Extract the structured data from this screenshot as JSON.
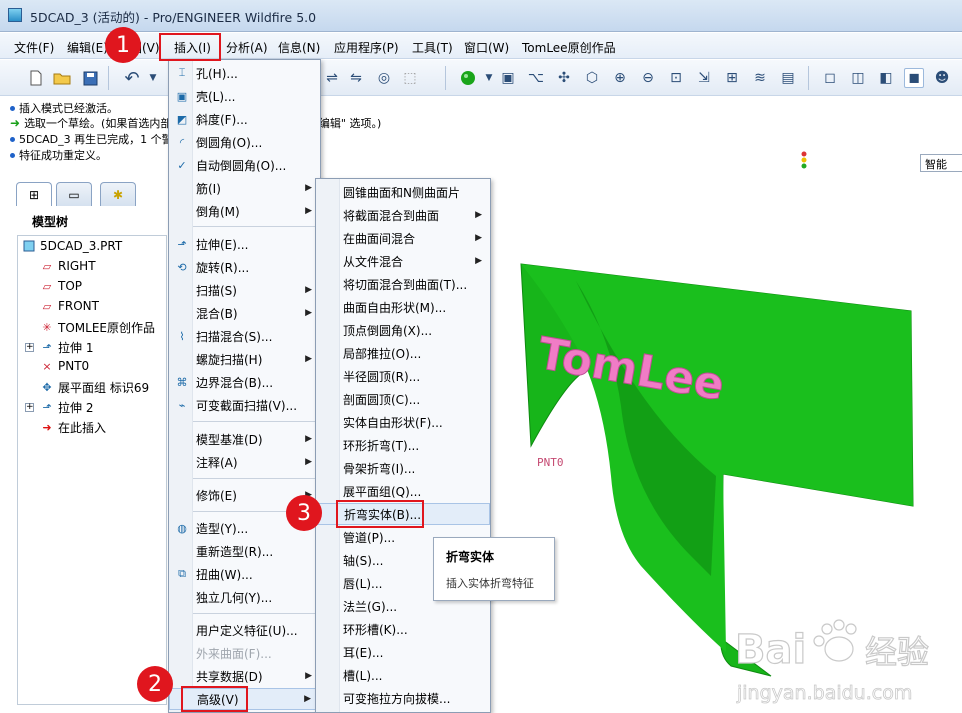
{
  "window": {
    "title": "5DCAD_3 (活动的) - Pro/ENGINEER Wildfire 5.0"
  },
  "menubar": {
    "items": [
      "文件(F)",
      "编辑(E)",
      "视图(V)",
      "插入(I)",
      "分析(A)",
      "信息(N)",
      "应用程序(P)",
      "工具(T)",
      "窗口(W)",
      "TomLee原创作品"
    ]
  },
  "messages": [
    {
      "icon": "info-bullet",
      "text": "插入模式已经激活。"
    },
    {
      "icon": "arrow-prompt",
      "text": "选取一个草绘。(如果首选内部草绘，可在 放置 面板中找到 \"编辑\" 选项。)"
    },
    {
      "icon": "info-bullet",
      "text": "5DCAD_3 再生已完成，1 个警告。"
    },
    {
      "icon": "info-bullet",
      "text": "特征成功重定义。"
    }
  ],
  "filter": {
    "value": "智能"
  },
  "model_tree": {
    "title": "模型树",
    "nodes": [
      {
        "label": "5DCAD_3.PRT",
        "icon": "part-icon"
      },
      {
        "label": "RIGHT",
        "icon": "datum-plane-icon"
      },
      {
        "label": "TOP",
        "icon": "datum-plane-icon"
      },
      {
        "label": "FRONT",
        "icon": "datum-plane-icon"
      },
      {
        "label": "TOMLEE原创作品",
        "icon": "csys-icon"
      },
      {
        "label": "拉伸 1",
        "icon": "extrude-icon"
      },
      {
        "label": "PNT0",
        "icon": "datum-point-icon"
      },
      {
        "label": "展平面组 标识69",
        "icon": "flatten-quilt-icon"
      },
      {
        "label": "拉伸 2",
        "icon": "extrude-icon"
      },
      {
        "label": "在此插入",
        "icon": "insert-here-arrow-icon"
      }
    ]
  },
  "insert_menu": {
    "items": [
      {
        "label": "孔(H)...",
        "icon": "hole-icon"
      },
      {
        "label": "壳(L)...",
        "icon": "shell-icon"
      },
      {
        "label": "斜度(F)...",
        "icon": "draft-icon"
      },
      {
        "label": "倒圆角(O)...",
        "icon": "round-icon"
      },
      {
        "label": "自动倒圆角(O)...",
        "icon": "auto-round-icon"
      },
      {
        "label": "筋(I)",
        "submenu": true
      },
      {
        "label": "倒角(M)",
        "submenu": true
      },
      {
        "label": "拉伸(E)...",
        "icon": "extrude-icon"
      },
      {
        "label": "旋转(R)...",
        "icon": "revolve-icon"
      },
      {
        "label": "扫描(S)",
        "submenu": true
      },
      {
        "label": "混合(B)",
        "submenu": true
      },
      {
        "label": "扫描混合(S)...",
        "icon": "swept-blend-icon"
      },
      {
        "label": "螺旋扫描(H)",
        "submenu": true
      },
      {
        "label": "边界混合(B)...",
        "icon": "boundary-blend-icon"
      },
      {
        "label": "可变截面扫描(V)...",
        "icon": "var-sweep-icon"
      },
      {
        "label": "模型基准(D)",
        "submenu": true
      },
      {
        "label": "注释(A)",
        "submenu": true
      },
      {
        "label": "修饰(E)",
        "submenu": true
      },
      {
        "label": "造型(Y)...",
        "icon": "style-icon"
      },
      {
        "label": "重新造型(R)..."
      },
      {
        "label": "扭曲(W)...",
        "icon": "warp-icon"
      },
      {
        "label": "独立几何(Y)..."
      },
      {
        "label": "用户定义特征(U)..."
      },
      {
        "label": "外来曲面(F)...",
        "disabled": true
      },
      {
        "label": "共享数据(D)",
        "submenu": true
      },
      {
        "label": "高级(V)",
        "submenu": true
      }
    ]
  },
  "advanced_menu": {
    "items": [
      "圆锥曲面和N侧曲面片",
      "将截面混合到曲面",
      "在曲面间混合",
      "从文件混合",
      "将切面混合到曲面(T)...",
      "曲面自由形状(M)...",
      "顶点倒圆角(X)...",
      "局部推拉(O)...",
      "半径圆顶(R)...",
      "剖面圆顶(C)...",
      "实体自由形状(F)...",
      "环形折弯(T)...",
      "骨架折弯(I)...",
      "展平面组(Q)...",
      "折弯实体(B)...",
      "管道(P)...",
      "轴(S)...",
      "唇(L)...",
      "法兰(G)...",
      "环形槽(K)...",
      "耳(E)...",
      "槽(L)...",
      "可变拖拉方向拔模..."
    ],
    "submenu_indices": [
      1,
      2,
      3
    ]
  },
  "tooltip": {
    "title": "折弯实体",
    "description": "插入实体折弯特征"
  },
  "annotations": {
    "step1": "1",
    "step2": "2",
    "step3": "3"
  },
  "graphics": {
    "point_label": "PNT0",
    "model_text": "TomLee"
  },
  "watermark": {
    "brand": "Bai",
    "brand_suffix": "经验",
    "url": "jingyan.baidu.com"
  },
  "colors": {
    "model_green": "#17b51a",
    "text_pink": "#f07cc6",
    "annotation_red": "#e0161e"
  }
}
